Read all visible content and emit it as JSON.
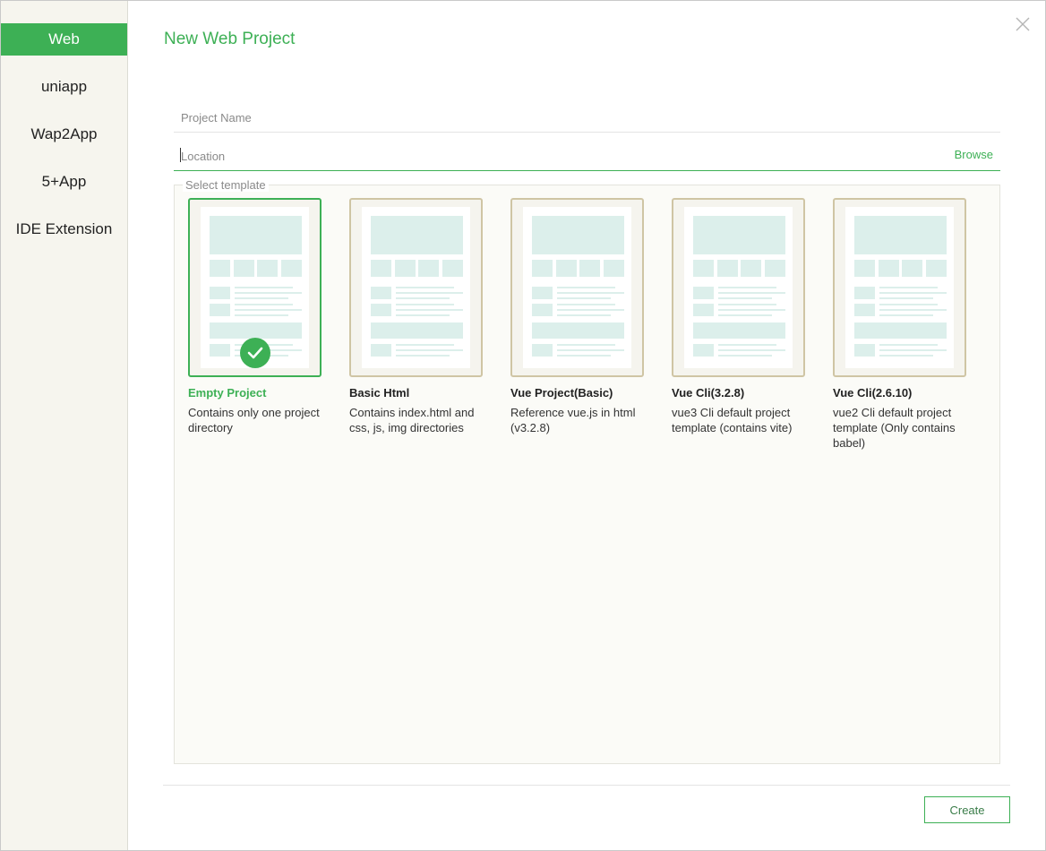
{
  "dialog": {
    "title": "New Web Project",
    "close_icon": "close-icon"
  },
  "sidebar": {
    "items": [
      {
        "label": "Web",
        "active": true
      },
      {
        "label": "uniapp",
        "active": false
      },
      {
        "label": "Wap2App",
        "active": false
      },
      {
        "label": "5+App",
        "active": false
      },
      {
        "label": "IDE Extension",
        "active": false
      }
    ]
  },
  "form": {
    "project_name_placeholder": "Project Name",
    "location_placeholder": "Location",
    "browse_label": "Browse"
  },
  "templates": {
    "legend": "Select template",
    "items": [
      {
        "name": "Empty Project",
        "description": "Contains only one project directory",
        "selected": true
      },
      {
        "name": "Basic Html",
        "description": "Contains index.html and css, js, img directories",
        "selected": false
      },
      {
        "name": "Vue Project(Basic)",
        "description": "Reference vue.js in html (v3.2.8)",
        "selected": false
      },
      {
        "name": "Vue Cli(3.2.8)",
        "description": "vue3 Cli default project template (contains vite)",
        "selected": false
      },
      {
        "name": "Vue Cli(2.6.10)",
        "description": "vue2 Cli default project template (Only contains babel)",
        "selected": false
      }
    ]
  },
  "footer": {
    "create_label": "Create"
  },
  "colors": {
    "accent": "#3db055",
    "sidebar_bg": "#f6f5ee",
    "card_border": "#cfc5a4",
    "thumb_block": "#dcefeb"
  }
}
